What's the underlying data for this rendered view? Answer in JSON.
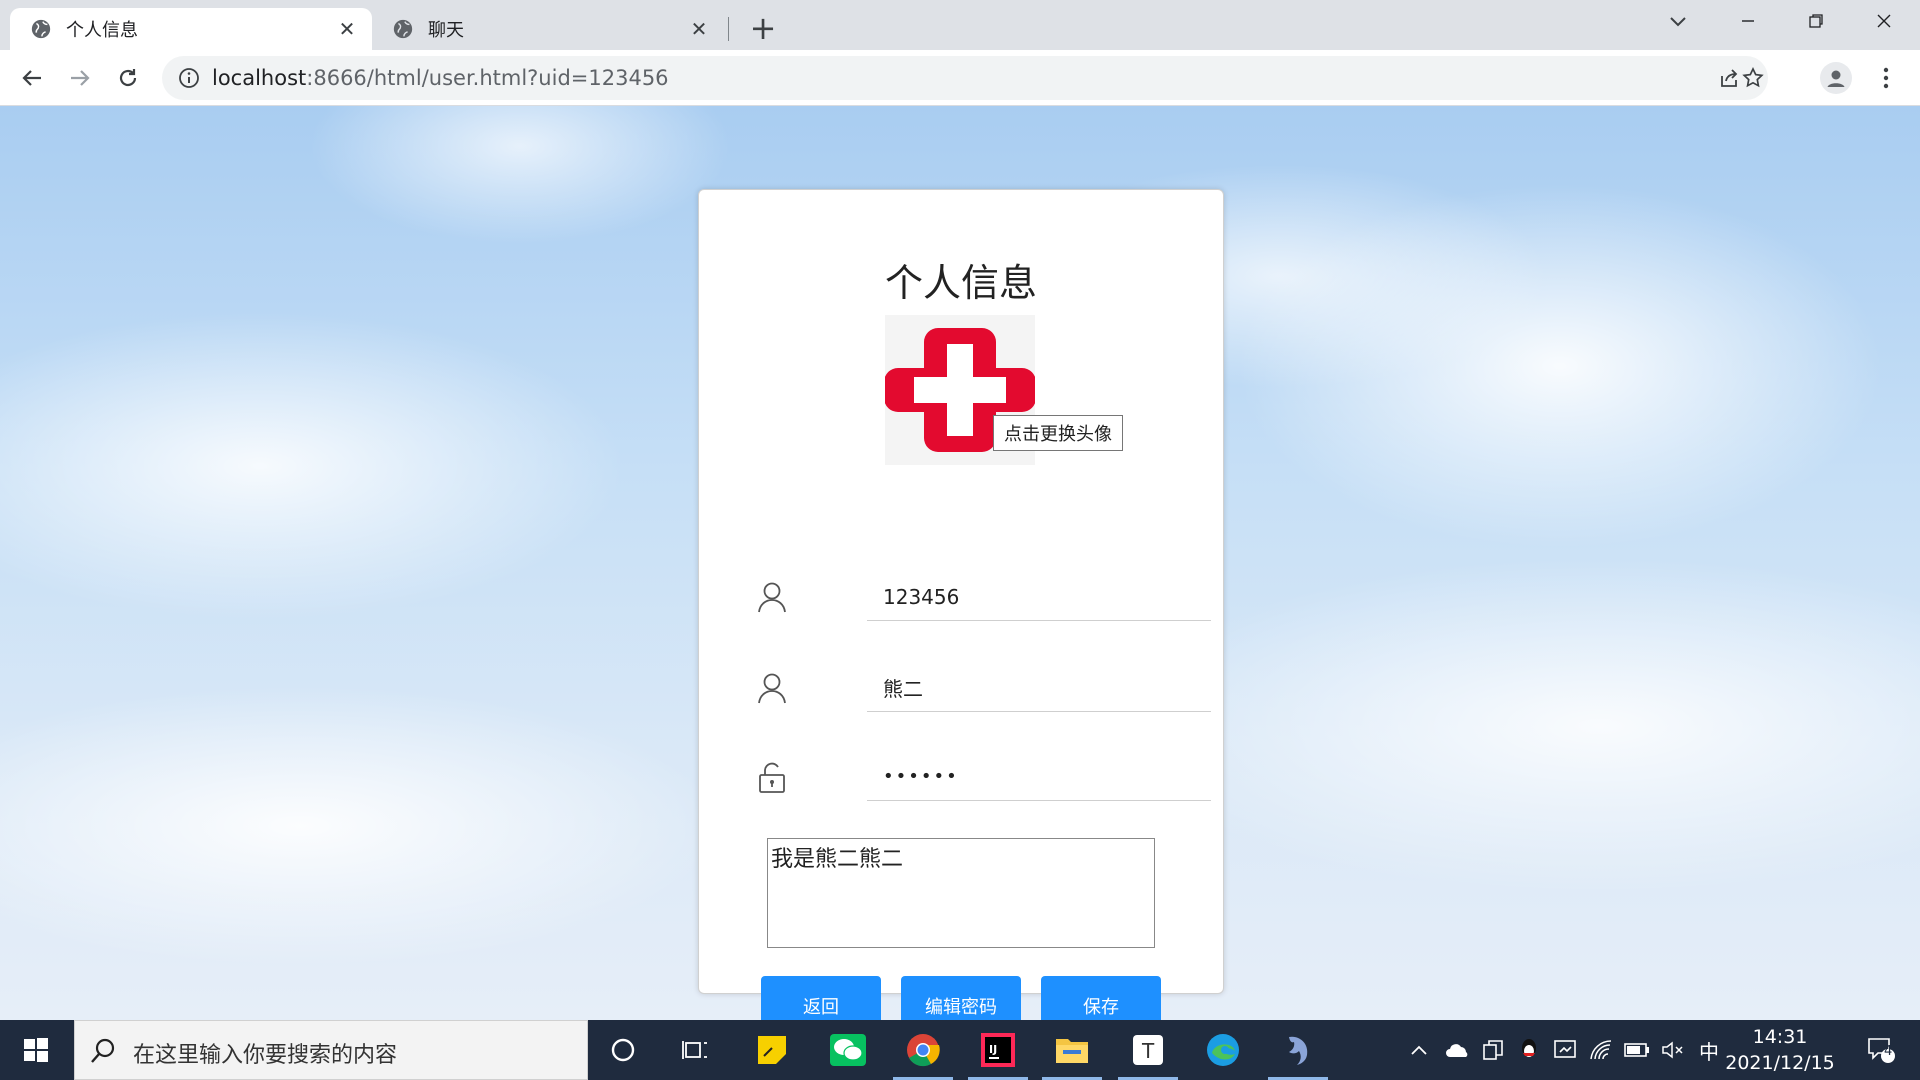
{
  "browser": {
    "tabs": [
      {
        "title": "个人信息",
        "active": true
      },
      {
        "title": "聊天",
        "active": false
      }
    ],
    "url_host": "localhost",
    "url_rest": ":8666/html/user.html?uid=123456"
  },
  "page": {
    "title": "个人信息",
    "avatar_tooltip": "点击更换头像",
    "uid_value": "123456",
    "nickname_value": "熊二",
    "password_value": "••••••",
    "bio_value": "我是熊二熊二",
    "buttons": {
      "back": "返回",
      "edit_password": "编辑密码",
      "save": "保存"
    },
    "accent_color": "#1e90ff",
    "avatar_color": "#e30a2f"
  },
  "taskbar": {
    "search_placeholder": "在这里输入你要搜索的内容",
    "ime": "中",
    "time": "14:31",
    "date": "2021/12/15",
    "notification_count": "4"
  }
}
